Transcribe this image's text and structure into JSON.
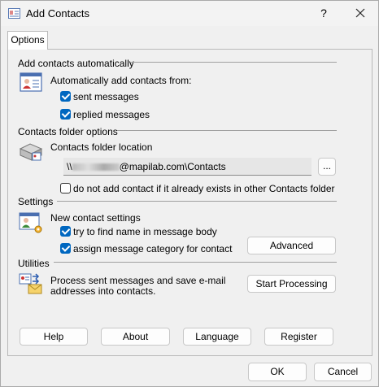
{
  "window": {
    "title": "Add Contacts",
    "help_glyph": "?",
    "close_glyph": "✕"
  },
  "tabs": [
    {
      "label": "Options"
    }
  ],
  "auto_add": {
    "heading": "Add contacts automatically",
    "label": "Automatically add contacts from:",
    "sent_label": "sent messages",
    "sent_checked": true,
    "replied_label": "replied messages",
    "replied_checked": true
  },
  "folder": {
    "heading": "Contacts folder options",
    "label": "Contacts folder location",
    "path_prefix": "\\\\",
    "path_suffix": "@mapilab.com\\Contacts",
    "browse_label": "...",
    "skip_label": "do not add contact if it already exists in other Contacts folder",
    "skip_checked": false
  },
  "settings": {
    "heading": "Settings",
    "label": "New contact settings",
    "find_name_label": "try to find name in message body",
    "find_name_checked": true,
    "category_label": "assign message category for contact",
    "category_checked": true,
    "advanced_label": "Advanced"
  },
  "utilities": {
    "heading": "Utilities",
    "line1": "Process sent messages and save e-mail",
    "line2": "addresses into contacts.",
    "start_label": "Start Processing"
  },
  "bottom_buttons": {
    "help": "Help",
    "about": "About",
    "language": "Language",
    "register": "Register"
  },
  "footer": {
    "ok": "OK",
    "cancel": "Cancel"
  }
}
